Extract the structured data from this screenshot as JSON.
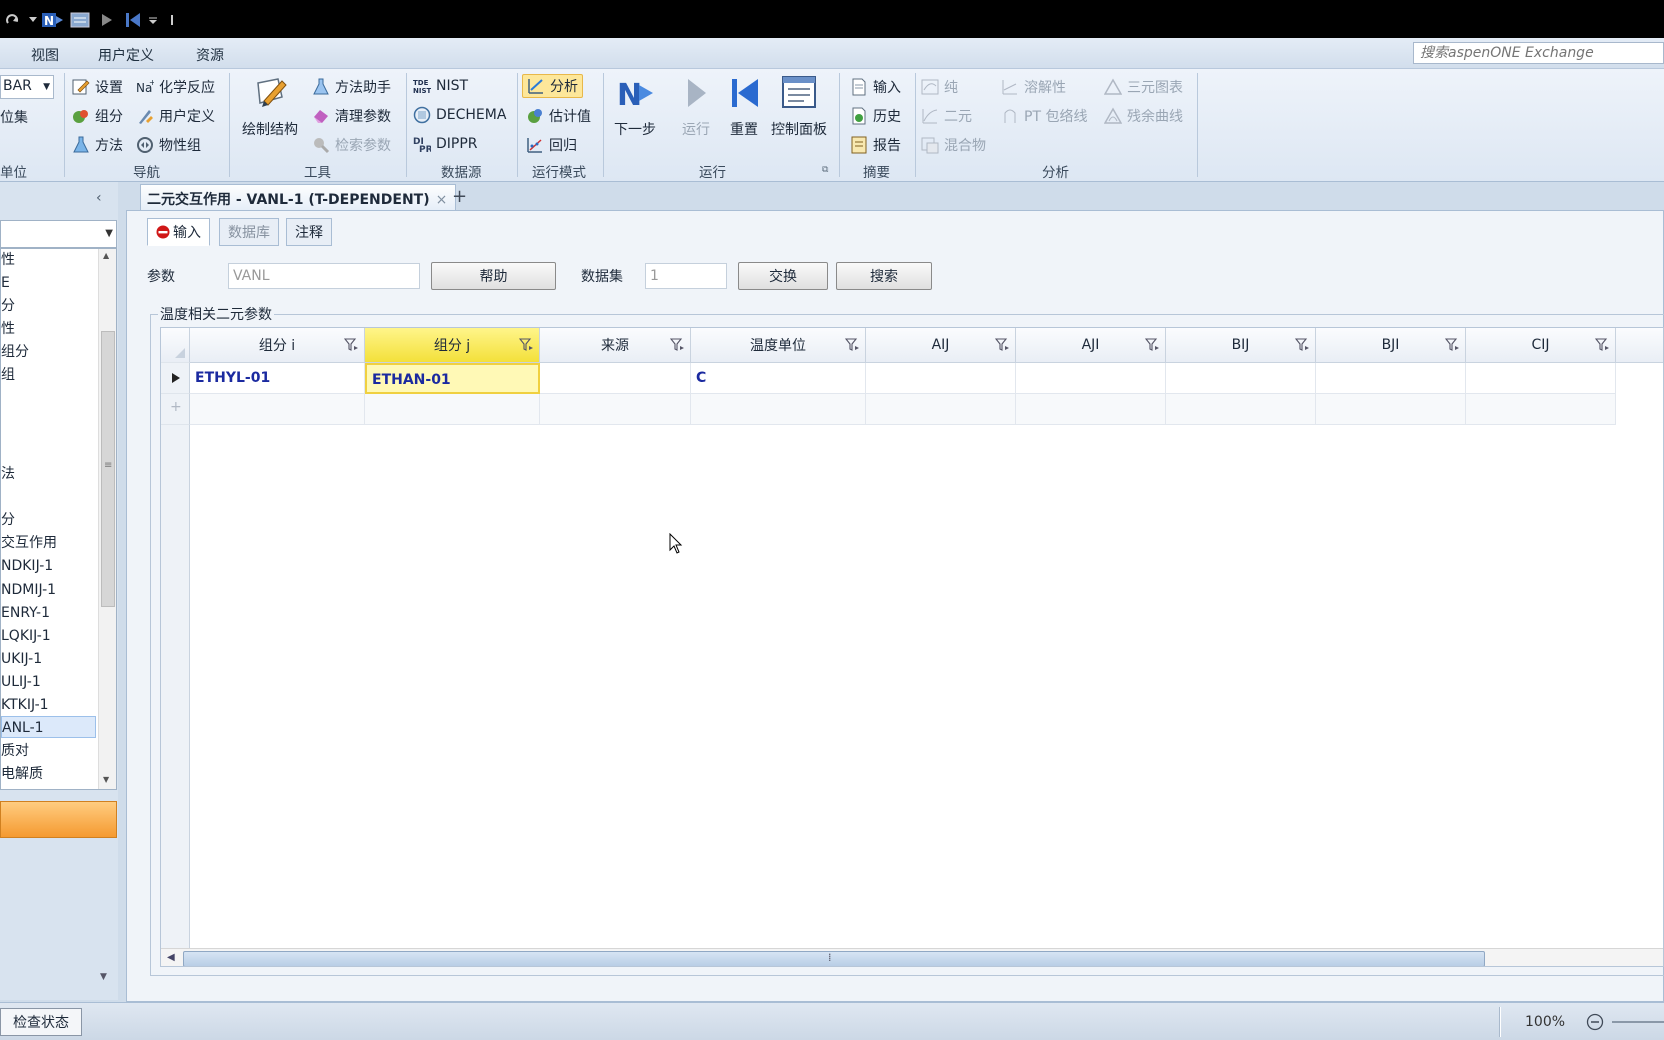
{
  "menu": {
    "tabs": [
      "视图",
      "用户定义",
      "资源"
    ],
    "search_placeholder": "搜索aspenONE Exchange"
  },
  "ribbon": {
    "units_combo": "BAR",
    "units_set": "位集",
    "units_group": "单位",
    "nav": {
      "label": "导航",
      "items": [
        "设置",
        "组分",
        "方法",
        "化学反应",
        "用户定义",
        "物性组"
      ]
    },
    "tools": {
      "label": "工具",
      "draw": "绘制结构",
      "items": [
        "方法助手",
        "清理参数",
        "检索参数"
      ]
    },
    "datasource": {
      "label": "数据源",
      "items": [
        "NIST",
        "DECHEMA",
        "DIPPR"
      ]
    },
    "runmode": {
      "label": "运行模式",
      "items": [
        "分析",
        "估计值",
        "回归"
      ]
    },
    "run": {
      "label": "运行",
      "buttons": [
        "下一步",
        "运行",
        "重置",
        "控制面板"
      ]
    },
    "summary": {
      "label": "摘要",
      "items": [
        "输入",
        "历史",
        "报告"
      ]
    },
    "analysis": {
      "label": "分析",
      "items": [
        "纯",
        "二元",
        "混合物",
        "溶解性",
        "PT 包络线",
        "三元图表",
        "残余曲线"
      ]
    }
  },
  "nav_tree": {
    "items": [
      "性",
      "E",
      "分",
      "性",
      "组分",
      "组",
      "法",
      "分",
      "交互作用",
      "NDKIJ-1",
      "NDMIJ-1",
      "ENRY-1",
      "LQKIJ-1",
      "UKIJ-1",
      "ULIJ-1",
      "KTKIJ-1",
      "ANL-1",
      "质对",
      "电解质"
    ],
    "selected": "ANL-1"
  },
  "document_tab": {
    "title": "二元交互作用 - VANL-1 (T-DEPENDENT)",
    "close": "×",
    "add": "+"
  },
  "form": {
    "subtabs": [
      "输入",
      "数据库",
      "注释"
    ],
    "param_label": "参数",
    "param_value": "VANL",
    "help_button": "帮助",
    "dataset_label": "数据集",
    "dataset_value": "1",
    "swap_button": "交换",
    "search_button": "搜索",
    "group_title": "温度相关二元参数"
  },
  "grid": {
    "columns": [
      "组分 i",
      "组分 j",
      "来源",
      "温度单位",
      "AIJ",
      "AJI",
      "BIJ",
      "BJI",
      "CIJ"
    ],
    "selected_column": "组分 j",
    "rows": [
      [
        "ETHYL-01",
        "ETHAN-01",
        "",
        "C",
        "",
        "",
        "",
        "",
        ""
      ]
    ]
  },
  "status": {
    "check_button": "检查状态",
    "zoom": "100%"
  },
  "colors": {
    "accent_blue": "#1b2aa0",
    "selection_yellow": "#f3e03a",
    "titlebar": "#000000"
  }
}
